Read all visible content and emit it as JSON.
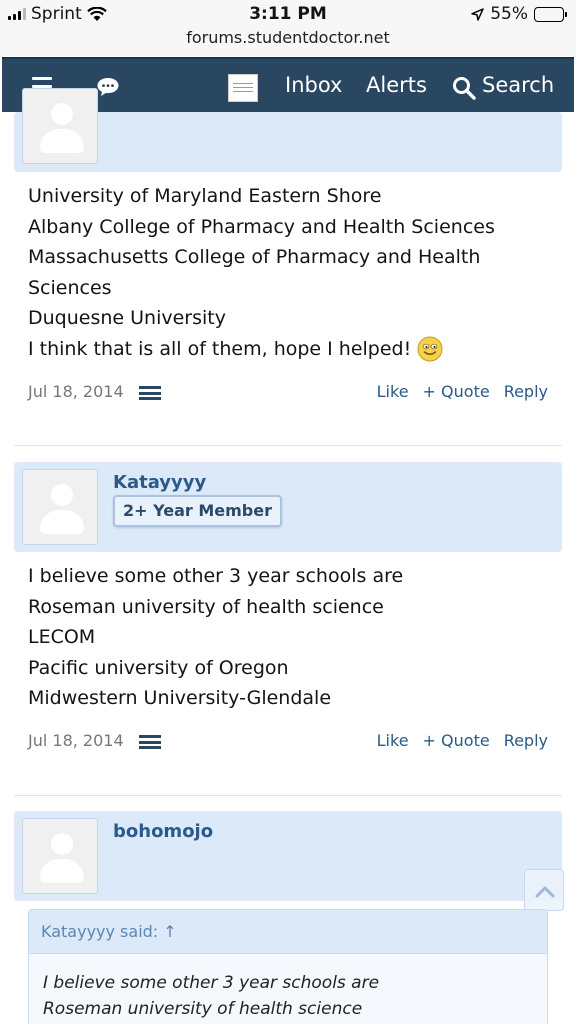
{
  "status_bar": {
    "carrier": "Sprint",
    "time": "3:11 PM",
    "battery": "55%",
    "battery_level": 0.55,
    "url": "forums.studentdoctor.net"
  },
  "navbar": {
    "inbox": "Inbox",
    "alerts": "Alerts",
    "search": "Search"
  },
  "posts": [
    {
      "lines": [
        "University of Maryland Eastern Shore",
        "Albany College of Pharmacy and Health Sciences",
        "Massachusetts College of Pharmacy and Health",
        "Sciences",
        "Duquesne University",
        "I think that is all of them, hope I helped!"
      ],
      "date": "Jul 18, 2014",
      "like": "Like",
      "quote": "+ Quote",
      "reply": "Reply"
    },
    {
      "username": "Katayyyy",
      "badge": "2+ Year Member",
      "lines": [
        "I believe some other 3 year schools are",
        "Roseman university of health science",
        "LECOM",
        "Pacific university of Oregon",
        "Midwestern University-Glendale"
      ],
      "date": "Jul 18, 2014",
      "like": "Like",
      "quote": "+ Quote",
      "reply": "Reply"
    },
    {
      "username": "bohomojo",
      "quote_author": "Katayyyy said: ↑",
      "quote_lines": [
        "I believe some other 3 year schools are",
        "Roseman university of health science"
      ]
    }
  ],
  "colors": {
    "navbar": "#2a4761",
    "userbar": "#dbe9f8",
    "link": "#2b5a8a"
  }
}
